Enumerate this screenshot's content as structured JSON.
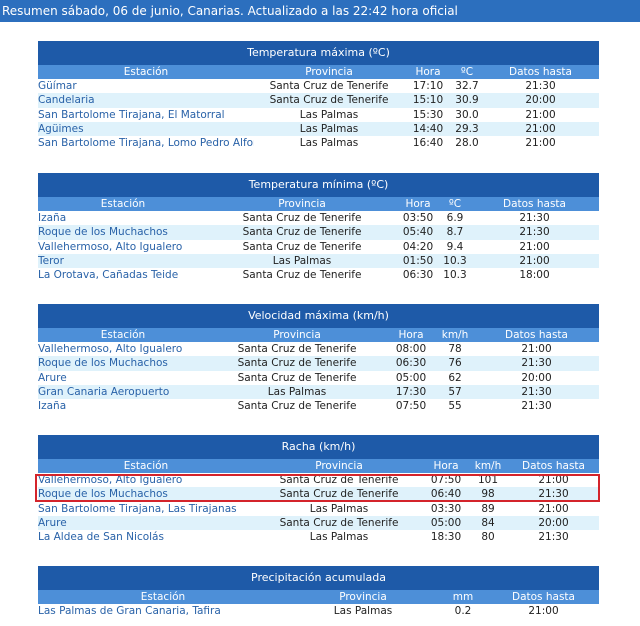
{
  "header": {
    "text": "Resumen sábado, 06 de junio, Canarias. Actualizado a las 22:42 hora oficial"
  },
  "tables": [
    {
      "title": "Temperatura máxima (ºC)",
      "headers": [
        "Estación",
        "Provincia",
        "Hora",
        "ºC",
        "Datos hasta"
      ],
      "rows": [
        [
          "Güímar",
          "Santa Cruz de Tenerife",
          "17:10",
          "32.7",
          "21:30"
        ],
        [
          "Candelaria",
          "Santa Cruz de Tenerife",
          "15:10",
          "30.9",
          "20:00"
        ],
        [
          "San Bartolome Tirajana, El Matorral",
          "Las Palmas",
          "15:30",
          "30.0",
          "21:00"
        ],
        [
          "Agüimes",
          "Las Palmas",
          "14:40",
          "29.3",
          "21:00"
        ],
        [
          "San Bartolome Tirajana, Lomo Pedro Alfonso",
          "Las Palmas",
          "16:40",
          "28.0",
          "21:00"
        ]
      ]
    },
    {
      "title": "Temperatura mínima (ºC)",
      "headers": [
        "Estación",
        "Provincia",
        "Hora",
        "ºC",
        "Datos hasta"
      ],
      "rows": [
        [
          "Izaña",
          "Santa Cruz de Tenerife",
          "03:50",
          "6.9",
          "21:30"
        ],
        [
          "Roque de los Muchachos",
          "Santa Cruz de Tenerife",
          "05:40",
          "8.7",
          "21:30"
        ],
        [
          "Vallehermoso, Alto Igualero",
          "Santa Cruz de Tenerife",
          "04:20",
          "9.4",
          "21:00"
        ],
        [
          "Teror",
          "Las Palmas",
          "01:50",
          "10.3",
          "21:00"
        ],
        [
          "La Orotava, Cañadas Teide",
          "Santa Cruz de Tenerife",
          "06:30",
          "10.3",
          "18:00"
        ]
      ]
    },
    {
      "title": "Velocidad máxima (km/h)",
      "headers": [
        "Estación",
        "Provincia",
        "Hora",
        "km/h",
        "Datos hasta"
      ],
      "rows": [
        [
          "Vallehermoso, Alto Igualero",
          "Santa Cruz de Tenerife",
          "08:00",
          "78",
          "21:00"
        ],
        [
          "Roque de los Muchachos",
          "Santa Cruz de Tenerife",
          "06:30",
          "76",
          "21:30"
        ],
        [
          "Arure",
          "Santa Cruz de Tenerife",
          "05:00",
          "62",
          "20:00"
        ],
        [
          "Gran Canaria Aeropuerto",
          "Las Palmas",
          "17:30",
          "57",
          "21:30"
        ],
        [
          "Izaña",
          "Santa Cruz de Tenerife",
          "07:50",
          "55",
          "21:30"
        ]
      ]
    },
    {
      "title": "Racha (km/h)",
      "headers": [
        "Estación",
        "Provincia",
        "Hora",
        "km/h",
        "Datos hasta"
      ],
      "rows": [
        [
          "Vallehermoso, Alto Igualero",
          "Santa Cruz de Tenerife",
          "07:50",
          "101",
          "21:00"
        ],
        [
          "Roque de los Muchachos",
          "Santa Cruz de Tenerife",
          "06:40",
          "98",
          "21:30"
        ],
        [
          "San Bartolome Tirajana, Las Tirajanas",
          "Las Palmas",
          "03:30",
          "89",
          "21:00"
        ],
        [
          "Arure",
          "Santa Cruz de Tenerife",
          "05:00",
          "84",
          "20:00"
        ],
        [
          "La Aldea de San Nicolás",
          "Las Palmas",
          "18:30",
          "80",
          "21:30"
        ]
      ]
    },
    {
      "title": "Precipitación acumulada",
      "headers": [
        "Estación",
        "Provincia",
        "mm",
        "Datos hasta"
      ],
      "rows": [
        [
          "Las Palmas de Gran Canaria, Tafira",
          "Las Palmas",
          "0.2",
          "21:00"
        ]
      ]
    }
  ],
  "colors": {
    "topbar": "#2c6fbe",
    "caption": "#1e5aa8",
    "header_row": "#4d8fd8",
    "row_alt": "#dff2fb",
    "station_text": "#2962a8",
    "highlight_border": "#d4242b"
  }
}
